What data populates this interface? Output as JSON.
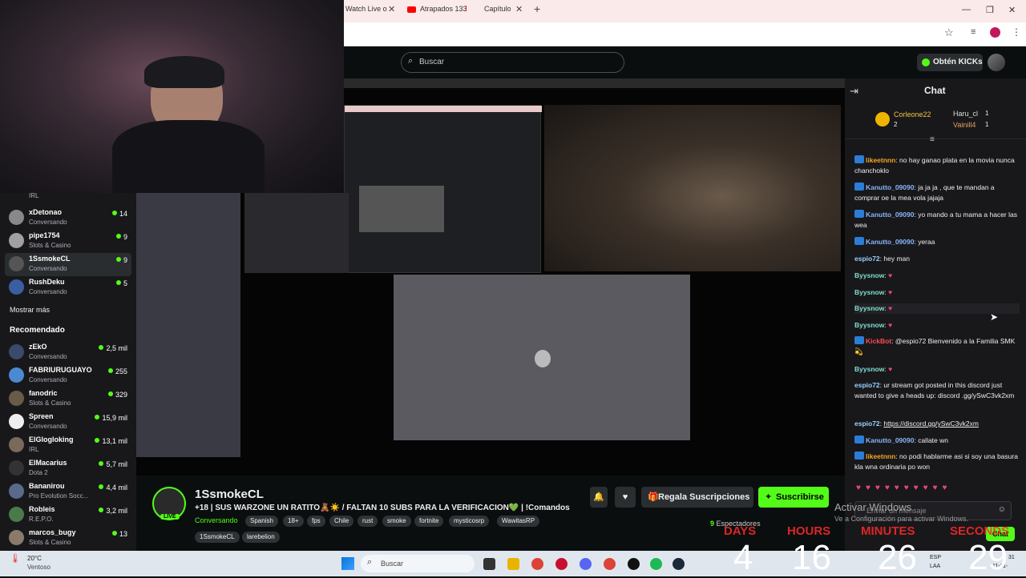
{
  "browser": {
    "tabs": [
      {
        "label": "Watch Live o"
      },
      {
        "label": "Atrapados 133"
      },
      {
        "label": "Capítulo"
      }
    ]
  },
  "header": {
    "search_placeholder": "Buscar",
    "kicks_button": "Obtén KICKs"
  },
  "sidebar": {
    "following": [
      {
        "name": "",
        "category": "IRL",
        "viewers": ""
      },
      {
        "name": "xDetonao",
        "category": "Conversando",
        "viewers": "14"
      },
      {
        "name": "pipe1754",
        "category": "Slots & Casino",
        "viewers": "9"
      },
      {
        "name": "1SsmokeCL",
        "category": "Conversando",
        "viewers": "9"
      },
      {
        "name": "RushDeku",
        "category": "Conversando",
        "viewers": "5"
      }
    ],
    "show_more": "Mostrar más",
    "recommended_title": "Recomendado",
    "recommended": [
      {
        "name": "zEkO",
        "category": "Conversando",
        "viewers": "2,5 mil"
      },
      {
        "name": "FABRIURUGUAYO",
        "category": "Conversando",
        "viewers": "255"
      },
      {
        "name": "fanodric",
        "category": "Slots & Casino",
        "viewers": "329"
      },
      {
        "name": "Spreen",
        "category": "Conversando",
        "viewers": "15,9 mil"
      },
      {
        "name": "ElGlogloking",
        "category": "IRL",
        "viewers": "13,1 mil"
      },
      {
        "name": "ElMacarius",
        "category": "Dota 2",
        "viewers": "5,7 mil"
      },
      {
        "name": "Bananirou",
        "category": "Pro Evolution Socc...",
        "viewers": "4,4 mil"
      },
      {
        "name": "Robleis",
        "category": "R.E.P.O.",
        "viewers": "3,2 mil"
      },
      {
        "name": "marcos_bugy",
        "category": "Slots & Casino",
        "viewers": "13"
      }
    ]
  },
  "stream_info": {
    "channel": "1SsmokeCL",
    "live_badge": "LIVE",
    "title": "+18 | SUS WARZONE UN RATITO🧸☀️ / FALTAN 10 SUBS PARA LA VERIFICACION💚 | !Comandos",
    "category": "Conversando",
    "tags": [
      "Spanish",
      "18+",
      "fps",
      "Chile",
      "rust",
      "smoke",
      "fortnite",
      "mysticosrp",
      "WawitasRP"
    ],
    "tags_row2": [
      "1SsmokeCL",
      "larebelion"
    ],
    "gift_button": "Regala Suscripciones",
    "subscribe_button": "Suscribirse",
    "viewers": "9",
    "viewers_label": "Espectadores"
  },
  "chat": {
    "title": "Chat",
    "top_gifters": [
      {
        "name": "Corleone22",
        "count": "2"
      },
      {
        "name": "Haru_cl",
        "count": "1"
      },
      {
        "name": "Vainill4",
        "count": "1"
      }
    ],
    "messages": [
      {
        "user": "likeetnnn",
        "color": "#f5a623",
        "text": "no hay ganao plata en la movia nunca chanchoklo"
      },
      {
        "user": "Kanutto_09090",
        "color": "#8ab4f8",
        "text": "ja ja ja , que te mandan a comprar oe la mea vola jajaja"
      },
      {
        "user": "Kanutto_09090",
        "color": "#8ab4f8",
        "text": "yo mando a tu mama a hacer las wea"
      },
      {
        "user": "Kanutto_09090",
        "color": "#8ab4f8",
        "text": "yeraa"
      },
      {
        "user": "espio72",
        "color": "#9ad1ff",
        "text": "hey man"
      },
      {
        "user": "Byysnow",
        "color": "#7fe0d0",
        "text": ""
      },
      {
        "user": "Byysnow",
        "color": "#7fe0d0",
        "text": ""
      },
      {
        "user": "Byysnow",
        "color": "#7fe0d0",
        "text": ""
      },
      {
        "user": "Byysnow",
        "color": "#7fe0d0",
        "text": ""
      },
      {
        "user": "KickBot",
        "color": "#ff4d4d",
        "text": "@espio72 Bienvenido a la Familia SMK💫"
      },
      {
        "user": "Byysnow",
        "color": "#7fe0d0",
        "text": ""
      },
      {
        "user": "espio72",
        "color": "#9ad1ff",
        "text": "ur stream got posted in this discord just wanted to give a heads up: discord .gg/ySwC3vk2xm"
      },
      {
        "user": "espio72",
        "color": "#9ad1ff",
        "text": "https://discord.gg/ySwC3vk2xm"
      },
      {
        "user": "Kanutto_09090",
        "color": "#8ab4f8",
        "text": "callate wn"
      },
      {
        "user": "likeetnnn",
        "color": "#f5a623",
        "text": "no podi hablarme asi si soy una basura kla wna ordinaria po won"
      }
    ],
    "input_placeholder": "Enviar un mensaje",
    "send_button": "Chat"
  },
  "overlay": {
    "activate_title": "Activar Windows",
    "activate_sub": "Ve a Configuración para activar Windows.",
    "countdown_labels": [
      "DAYS",
      "HOURS",
      "MINUTES",
      "SECONDS"
    ],
    "countdown_values": [
      "4",
      "16",
      "26",
      "29"
    ]
  },
  "taskbar": {
    "weather_temp": "20°C",
    "weather_desc": "Ventoso",
    "search": "Buscar",
    "lang": "ESP",
    "lang2": "LAA",
    "time": "31",
    "date": "11-11-"
  }
}
